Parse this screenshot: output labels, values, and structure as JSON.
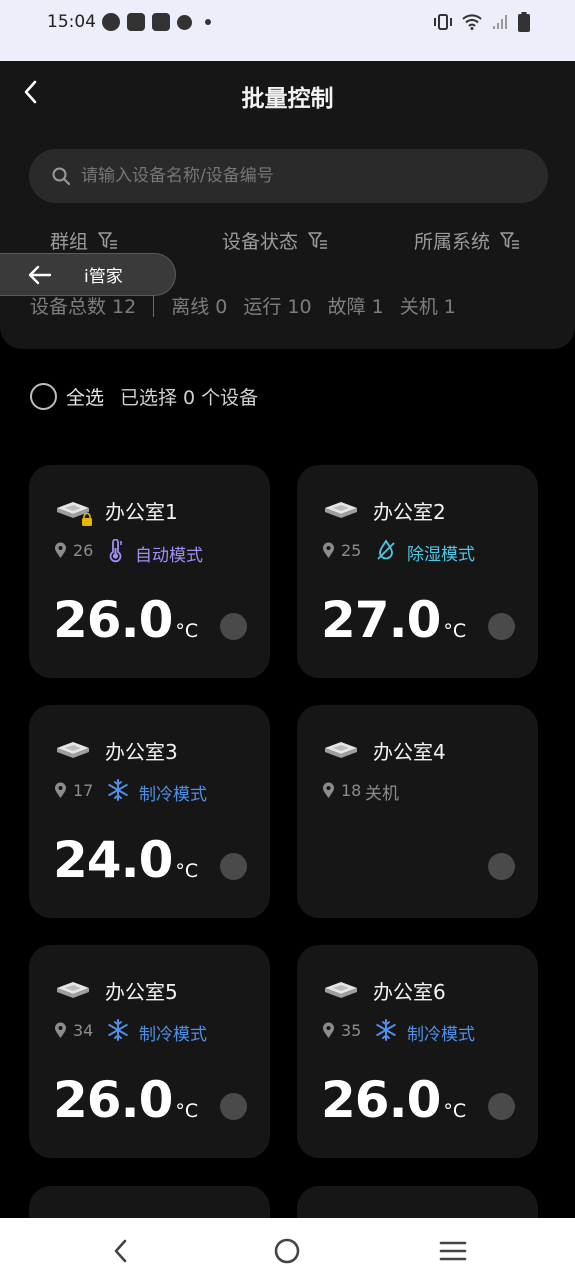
{
  "status_bar": {
    "time": "15:04",
    "left_icons": [
      "speedometer-icon",
      "mail-icon",
      "mail-icon",
      "shield-icon",
      "dot"
    ],
    "right_icons": [
      "vibrate-icon",
      "wifi-icon",
      "signal-icon",
      "battery-icon"
    ]
  },
  "header": {
    "title": "批量控制",
    "search_placeholder": "请输入设备名称/设备编号",
    "filters": [
      "群组",
      "设备状态",
      "所属系统"
    ],
    "stats": {
      "total": "设备总数 12",
      "offline": "离线 0",
      "running": "运行 10",
      "fault": "故障 1",
      "off": "关机 1"
    }
  },
  "floating_pill": {
    "label": "i管家"
  },
  "selection": {
    "select_all_label": "全选",
    "selected_text": "已选择 0 个设备"
  },
  "devices": [
    {
      "name": "办公室1",
      "location": "26",
      "mode": "自动模式",
      "mode_icon": "thermometer-icon",
      "mode_color": "#a18ef5",
      "temp": "26.0",
      "unit": "°C",
      "locked": true
    },
    {
      "name": "办公室2",
      "location": "25",
      "mode": "除湿模式",
      "mode_icon": "droplet-icon",
      "mode_color": "#4ec7e6",
      "temp": "27.0",
      "unit": "°C",
      "locked": false
    },
    {
      "name": "办公室3",
      "location": "17",
      "mode": "制冷模式",
      "mode_icon": "snowflake-icon",
      "mode_color": "#4f8fe8",
      "temp": "24.0",
      "unit": "°C",
      "locked": false
    },
    {
      "name": "办公室4",
      "location": "18",
      "mode": "关机",
      "mode_icon": "",
      "mode_color": "#8c8c8c",
      "temp": "",
      "unit": "",
      "locked": false
    },
    {
      "name": "办公室5",
      "location": "34",
      "mode": "制冷模式",
      "mode_icon": "snowflake-icon",
      "mode_color": "#4f8fe8",
      "temp": "26.0",
      "unit": "°C",
      "locked": false
    },
    {
      "name": "办公室6",
      "location": "35",
      "mode": "制冷模式",
      "mode_icon": "snowflake-icon",
      "mode_color": "#4f8fe8",
      "temp": "26.0",
      "unit": "°C",
      "locked": false
    }
  ]
}
